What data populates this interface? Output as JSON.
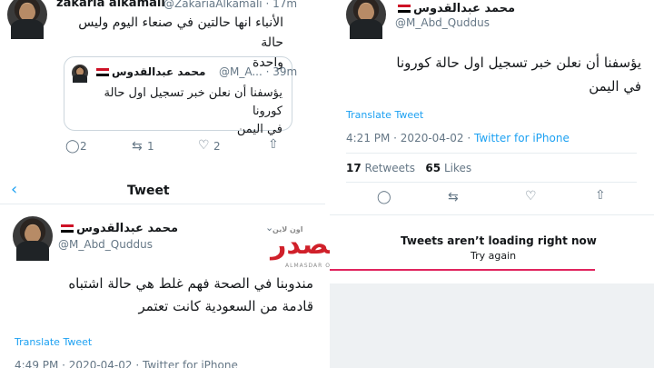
{
  "top_left_tweet": {
    "name": "zakaria alkamali",
    "handle": "@ZakariaAlkamali",
    "time": "17m",
    "text_line1": "الأنباء انها حالتين في صنعاء اليوم وليس حالة",
    "text_line2": "واحدة",
    "quote": {
      "name": "محمد عبدالقدوس",
      "handle": "@M_A...",
      "time": "39m",
      "text_line1": "يؤسفنا أن نعلن خبر تسجيل اول حالة كورونا",
      "text_line2": "في اليمن"
    },
    "reply_count": "2",
    "retweet_count": "1",
    "like_count": "2"
  },
  "bottom_left_tweet": {
    "back_icon": "chevron-left-icon",
    "header_title": "Tweet",
    "name": "محمد عبدالقدوس",
    "handle": "@M_Abd_Quddus",
    "text_line1": "مندوبنا في الصحة فهم غلط هي حالة اشتباه",
    "text_line2": "قادمة من السعودية كانت تعتمر",
    "translate": "Translate Tweet",
    "timestamp": "4:49 PM · 2020-04-02 · Twitter for iPhone"
  },
  "right_tweet": {
    "name": "محمد عبدالقدوس",
    "handle": "@M_Abd_Quddus",
    "text_line1": "يؤسفنا أن نعلن خبر تسجيل اول حالة كورونا",
    "text_line2": "في اليمن",
    "translate": "Translate Tweet",
    "time": "4:21 PM · 2020-04-02 · ",
    "source": "Twitter for iPhone",
    "retweets_num": "17",
    "retweets_label": "Retweets",
    "likes_num": "65",
    "likes_label": "Likes",
    "error_title": "Tweets aren’t loading right now",
    "error_retry": "Try again"
  },
  "watermark": {
    "arabic": "المصدر",
    "small": "اون لاين",
    "latin": "ALMASDAR ONLINE"
  },
  "colors": {
    "accent": "#1da1f2",
    "watermark": "#d0202a",
    "retry_bar": "#e0245e"
  }
}
